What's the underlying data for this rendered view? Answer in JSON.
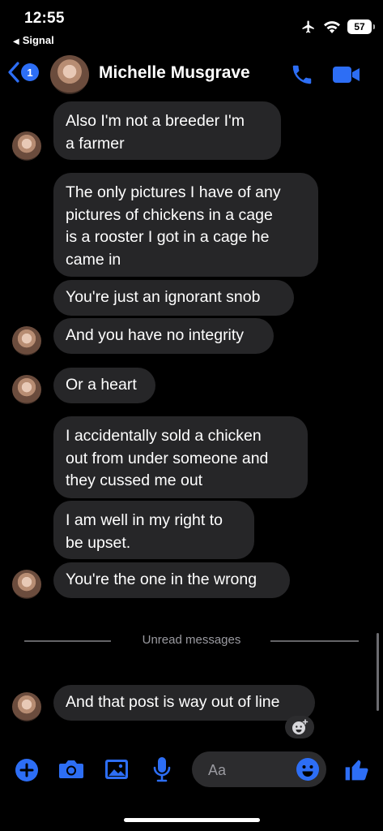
{
  "status_bar": {
    "time": "12:55",
    "back_app": "Signal",
    "battery": "57"
  },
  "header": {
    "unread_count": "1",
    "contact_name": "Michelle Musgrave",
    "accent_color": "#2d6ef5"
  },
  "messages": [
    {
      "text": "Also I'm not a breeder I'm\na farmer"
    },
    {
      "text": "The only pictures I have of any\npictures of chickens in a cage\nis a rooster I got in a cage he\ncame in"
    },
    {
      "text": "You're just an ignorant snob"
    },
    {
      "text": "And you have no integrity"
    },
    {
      "text": "Or a heart"
    },
    {
      "text": "I accidentally sold a chicken\nout from under someone and\nthey cussed me out"
    },
    {
      "text": "I am well in my right to\nbe upset."
    },
    {
      "text": "You're the one in the wrong"
    },
    {
      "text": "And that post is way out of line"
    }
  ],
  "divider": {
    "label": "Unread messages"
  },
  "composer": {
    "placeholder": "Aa",
    "icons": [
      "plus-icon",
      "camera-icon",
      "image-icon",
      "microphone-icon",
      "emoji-icon",
      "thumbs-up-icon"
    ]
  }
}
